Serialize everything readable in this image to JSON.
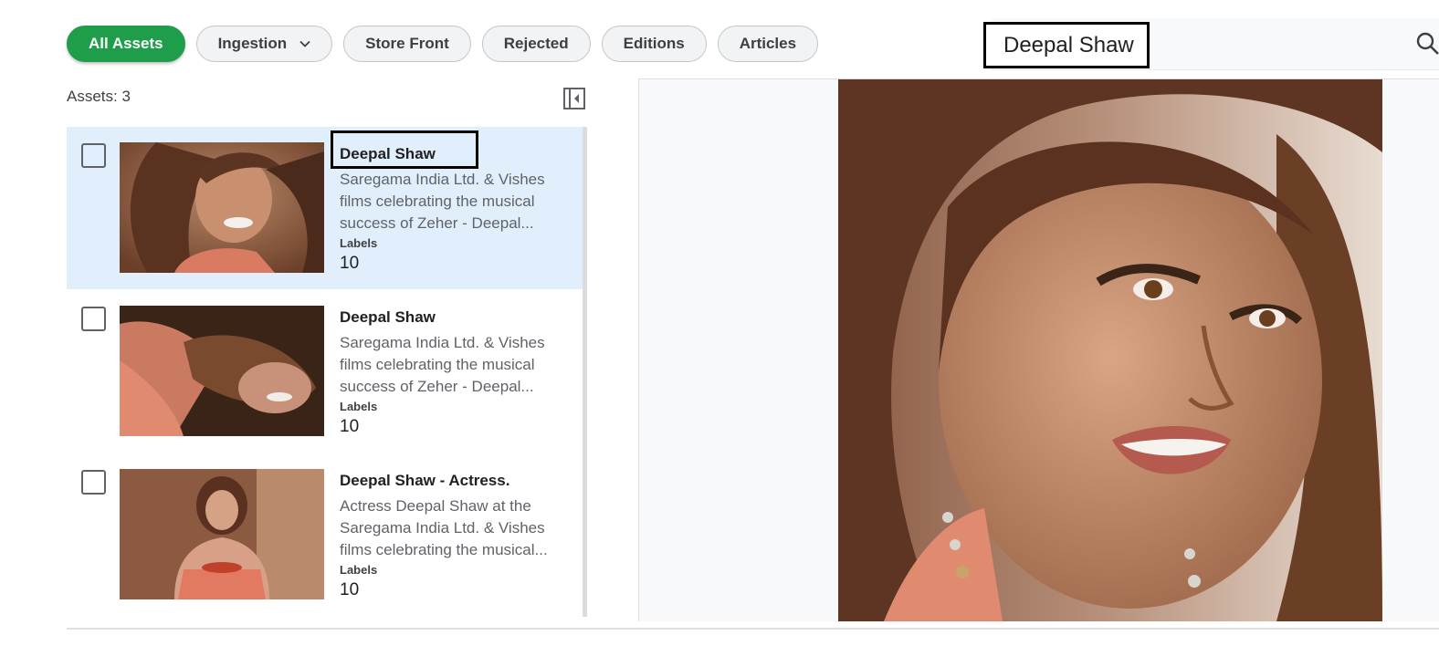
{
  "tabs": {
    "all_assets": "All Assets",
    "ingestion": "Ingestion",
    "store_front": "Store Front",
    "rejected": "Rejected",
    "editions": "Editions",
    "articles": "Articles"
  },
  "search": {
    "value": "Deepal Shaw"
  },
  "assets_count": "Assets: 3",
  "assets": [
    {
      "title": "Deepal Shaw",
      "description": "Saregama India Ltd. & Vishes films celebrating the musical success of Zeher - Deepal...",
      "labels_heading": "Labels",
      "labels_count": "10"
    },
    {
      "title": "Deepal Shaw",
      "description": "Saregama India Ltd. & Vishes films celebrating the musical success of Zeher - Deepal...",
      "labels_heading": "Labels",
      "labels_count": "10"
    },
    {
      "title": "Deepal Shaw - Actress.",
      "description": "Actress Deepal Shaw at the Saregama India Ltd. & Vishes films celebrating the musical...",
      "labels_heading": "Labels",
      "labels_count": "10"
    }
  ],
  "colors": {
    "accent": "#1e9e4a",
    "selected_row": "#e1effd"
  }
}
